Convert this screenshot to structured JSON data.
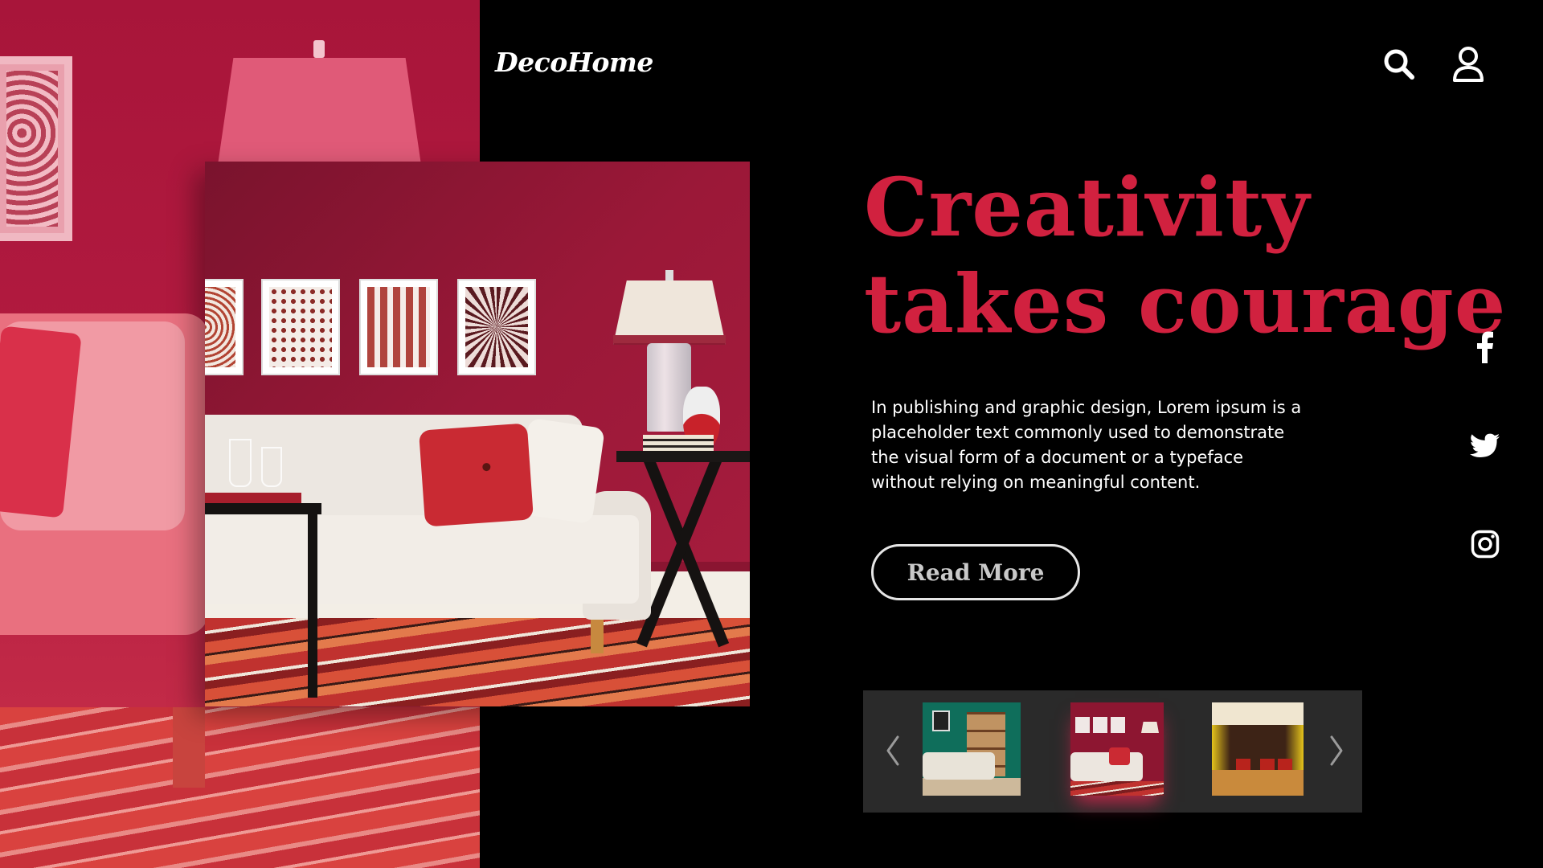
{
  "brand": {
    "logo_text": "DecoHome"
  },
  "header": {
    "search_icon": "search-icon",
    "user_icon": "user-icon"
  },
  "hero": {
    "headline_line1": "Creativity",
    "headline_line2": "takes courage",
    "body": "In publishing and graphic design, Lorem ipsum is a placeholder text commonly used to demonstrate the visual form of a document or a typeface without relying on meaningful content.",
    "cta_label": "Read More"
  },
  "social": [
    {
      "name": "facebook",
      "icon": "facebook-icon"
    },
    {
      "name": "twitter",
      "icon": "twitter-icon"
    },
    {
      "name": "instagram",
      "icon": "instagram-icon"
    }
  ],
  "carousel": {
    "prev_icon": "chevron-left-icon",
    "next_icon": "chevron-right-icon",
    "thumbnails": [
      {
        "theme": "green living room"
      },
      {
        "theme": "red living room",
        "active": true
      },
      {
        "theme": "yellow restaurant interior"
      }
    ]
  },
  "colors": {
    "accent": "#d1213f",
    "background": "#000000",
    "panel": "#b0163a",
    "carousel_bg": "#2a2a2a"
  }
}
